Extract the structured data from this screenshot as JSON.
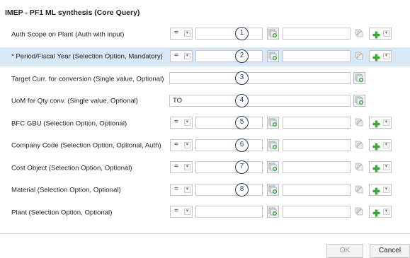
{
  "dialog": {
    "title": "IMEP - PF1 ML synthesis (Core Query)",
    "ok_label": "OK",
    "cancel_label": "Cancel"
  },
  "icons": {
    "select_value": "select-values-icon",
    "multi_select": "multiple-selection-icon",
    "add": "add-icon",
    "dropdown": "chevron-down-icon"
  },
  "colors": {
    "selected_row": "#d8e8f7",
    "badge_border": "#233a5e",
    "add_icon": "#3aa63a"
  },
  "rows": [
    {
      "label": "Auth Scope on Plant (Auth with input)",
      "type": "range",
      "operator": "=",
      "low": "",
      "high": "",
      "badge": "1",
      "selected": false
    },
    {
      "label": "* Period/Fiscal Year (Selection Option, Mandatory)",
      "type": "range",
      "operator": "=",
      "low": "",
      "high": "",
      "badge": "2",
      "selected": true
    },
    {
      "label": "Target Curr. for conversion (Single value, Optional)",
      "type": "single",
      "value": "",
      "badge": "3",
      "selected": false
    },
    {
      "label": "UoM for Qty conv. (Single value, Optional)",
      "type": "single",
      "value": "TO",
      "badge": "4",
      "selected": false
    },
    {
      "label": "BFC GBU (Selection Option, Optional)",
      "type": "range",
      "operator": "=",
      "low": "",
      "high": "",
      "badge": "5",
      "selected": false
    },
    {
      "label": "Company Code (Selection Option, Optional, Auth)",
      "type": "range",
      "operator": "=",
      "low": "",
      "high": "",
      "badge": "6",
      "selected": false
    },
    {
      "label": "Cost Object (Selection Option, Optional)",
      "type": "range",
      "operator": "=",
      "low": "",
      "high": "",
      "badge": "7",
      "selected": false
    },
    {
      "label": "Material (Selection Option, Optional)",
      "type": "range",
      "operator": "=",
      "low": "",
      "high": "",
      "badge": "8",
      "selected": false
    },
    {
      "label": "Plant (Selection Option, Optional)",
      "type": "range",
      "operator": "=",
      "low": "",
      "high": "",
      "badge": "",
      "selected": false
    }
  ]
}
